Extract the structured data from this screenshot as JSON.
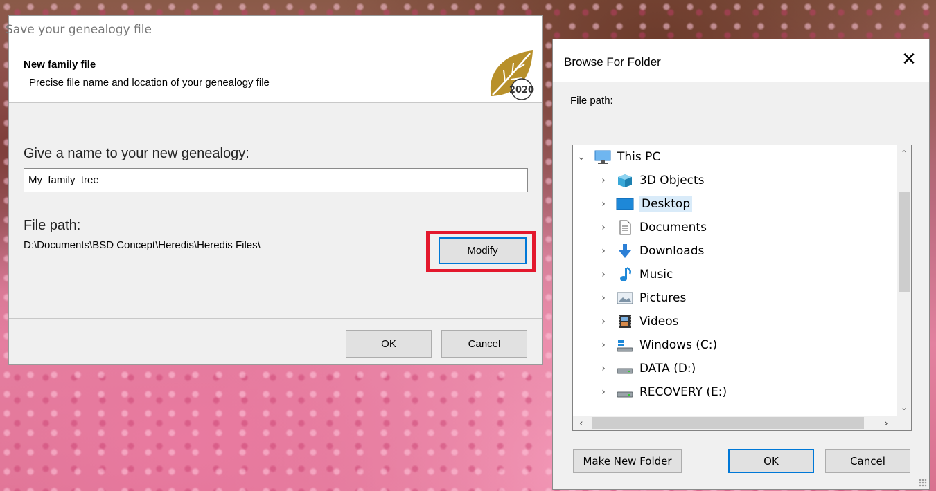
{
  "save_dialog": {
    "title": "Save your genealogy file",
    "header_title": "New family file",
    "header_subtitle": "Precise file name and location of your genealogy file",
    "logo_text": "2020",
    "name_label": "Give a name to your new genealogy:",
    "name_value": "My_family_tree",
    "path_label": "File path:",
    "path_value": "D:\\Documents\\BSD Concept\\Heredis\\Heredis Files\\",
    "modify_label": "Modify",
    "ok_label": "OK",
    "cancel_label": "Cancel"
  },
  "browse_dialog": {
    "title": "Browse For Folder",
    "path_label": "File path:",
    "tree": [
      {
        "label": "This PC",
        "icon": "computer-icon",
        "expanded": true,
        "level": 0
      },
      {
        "label": "3D Objects",
        "icon": "3d-objects-icon",
        "level": 1
      },
      {
        "label": "Desktop",
        "icon": "desktop-icon",
        "level": 1,
        "selected": true
      },
      {
        "label": "Documents",
        "icon": "documents-icon",
        "level": 1
      },
      {
        "label": "Downloads",
        "icon": "downloads-icon",
        "level": 1
      },
      {
        "label": "Music",
        "icon": "music-icon",
        "level": 1
      },
      {
        "label": "Pictures",
        "icon": "pictures-icon",
        "level": 1
      },
      {
        "label": "Videos",
        "icon": "videos-icon",
        "level": 1
      },
      {
        "label": "Windows (C:)",
        "icon": "windows-drive-icon",
        "level": 1
      },
      {
        "label": "DATA (D:)",
        "icon": "drive-icon",
        "level": 1
      },
      {
        "label": "RECOVERY (E:)",
        "icon": "drive-icon",
        "level": 1
      }
    ],
    "new_folder_label": "Make New Folder",
    "ok_label": "OK",
    "cancel_label": "Cancel"
  },
  "colors": {
    "highlight": "#e3182d",
    "accent": "#0078d7",
    "selection": "#d9ebf9"
  }
}
